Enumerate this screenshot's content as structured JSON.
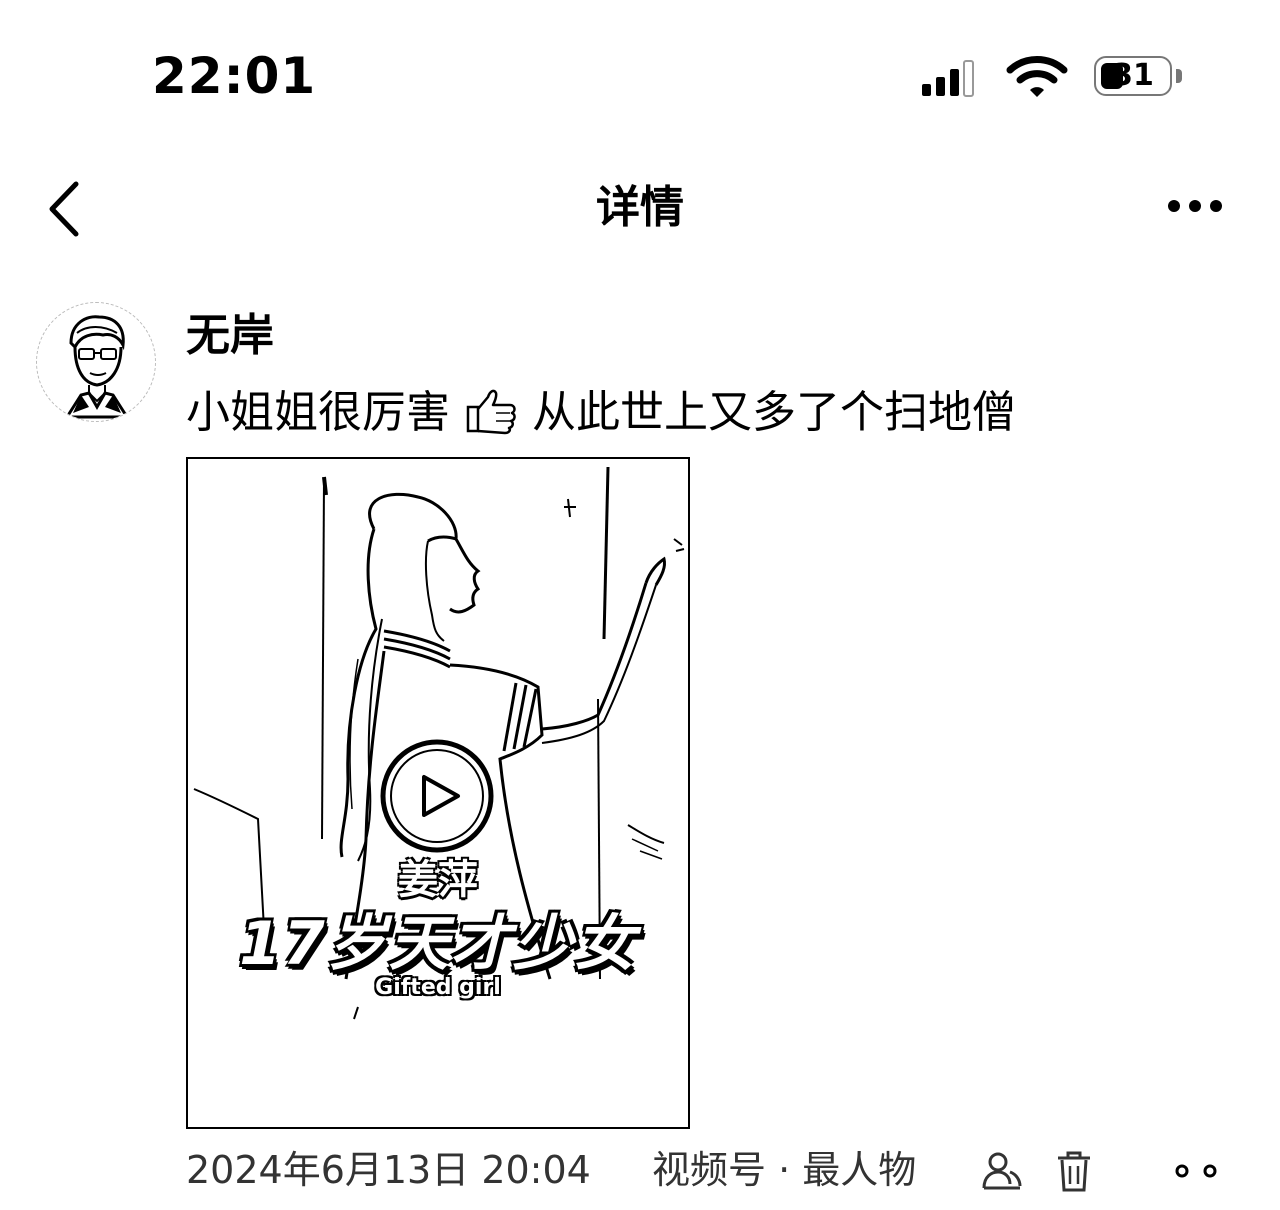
{
  "status_bar": {
    "time": "22:01",
    "battery_level": "31",
    "icons": [
      "signal-icon",
      "wifi-icon",
      "battery-icon"
    ]
  },
  "nav": {
    "title": "详情",
    "back_icon": "chevron-left-icon",
    "more_icon": "more-icon"
  },
  "post": {
    "author": "无岸",
    "text_before": "小姐姐很厉害",
    "emoji": "thumbs-up-icon",
    "text_after": "从此世上又多了个扫地僧",
    "video": {
      "caption_name": "姜萍",
      "caption_title": "17岁天才少女",
      "caption_sub": "Gifted girl",
      "play_icon": "play-icon"
    },
    "meta": {
      "datetime": "2024年6月13日 20:04",
      "source": "视频号 · 最人物",
      "icons": [
        "visibility-icon",
        "delete-icon",
        "more-dots-icon"
      ]
    }
  },
  "colors": {
    "background": "#ffffff",
    "text": "#000000",
    "meta_text": "#333333"
  }
}
